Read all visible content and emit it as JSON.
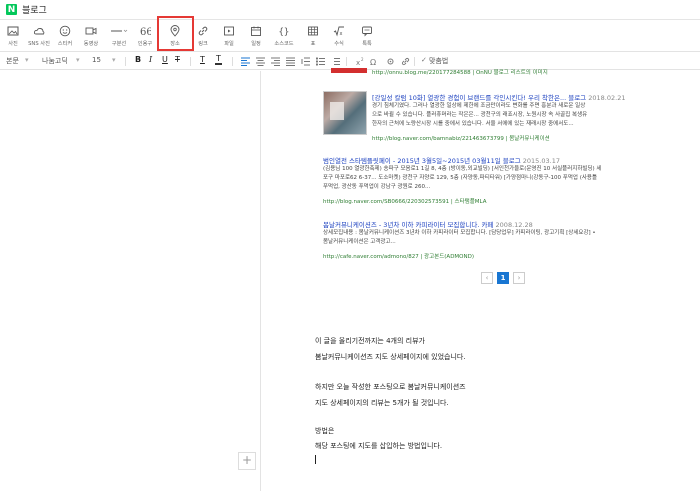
{
  "app": {
    "logo": "N",
    "title": "블로그"
  },
  "toolbar": {
    "items": [
      {
        "label": "사진",
        "icon": "photo-icon"
      },
      {
        "label": "SNS 사진",
        "icon": "cloud-icon"
      },
      {
        "label": "스티커",
        "icon": "sticker-icon"
      },
      {
        "label": "동영상",
        "icon": "video-icon"
      },
      {
        "label": "구분선",
        "icon": "divider-icon"
      },
      {
        "label": "인용구",
        "icon": "quote-icon"
      },
      {
        "label": "장소",
        "icon": "place-icon"
      },
      {
        "label": "링크",
        "icon": "link-icon"
      },
      {
        "label": "파일",
        "icon": "file-icon"
      },
      {
        "label": "일정",
        "icon": "calendar-icon"
      },
      {
        "label": "소스코드",
        "icon": "code-icon"
      },
      {
        "label": "표",
        "icon": "table-icon"
      },
      {
        "label": "수식",
        "icon": "formula-icon"
      },
      {
        "label": "톡톡",
        "icon": "talk-icon"
      }
    ]
  },
  "format": {
    "style": "본문",
    "font": "나눔고딕",
    "size": "15",
    "bold": "B",
    "italic": "I",
    "underline": "U",
    "strike": "T",
    "color": "T",
    "bgcolor": "T",
    "spellcheck": "맞춤법"
  },
  "results": [
    {
      "url": "http://onnu.blog.me/220177284588 | OnNU 블로그 리스트의 이미지"
    },
    {
      "title": "[강일성 칼럼 10화] 열광한 경험이 브랜드를 각인시킨다! 우리 착한은... 블로그",
      "date": "2018.02.21",
      "desc": [
        "경기 침체기였다. 그러나 열광한 일상에 제한에 조금만이라도 변화를 주면 흥분과 새로운 일상",
        "으로 바뀔 수 있습니다. 플러휴머라는 작은은... 광천구의 래죠시장, 노원시장 속 사골집 복생유",
        "한자의 근처에 노량산시장 시를 중에서 있습니다. 서울 서에에 있는 재래시장 중에서도..."
      ],
      "url": "http://blog.naver.com/bamnabiz/221463673799 | 봄날커뮤니케이션"
    },
    {
      "title": "범인열전 스타템플릿페이 - 2015년 3월5일~2015년 03월11일 블로그",
      "date": "2015.03.17",
      "desc": [
        "(김용님 100 열광한축제) 송파구 모음로1 1길 8, 4층 (방이동,외교빌딩) [서인천가을로(운영진 10 서실플러지하빌딩) 세",
        "포구 마포로62 6-37... 도소마켓) 광천구 자양로 129, 5층 (자양동,파티타워) [가양점마니(강동구-100 푸먹업 (사용틀",
        "푸먹업, 광산동 푸먹업이 강남구 광원로 260..."
      ],
      "url": "http://blog.naver.com/SB0666/220302573591 | 스타탬플MLA"
    },
    {
      "title": "봄날커뮤니케이션즈 - 3년차 이하 카피라이터 모집합니다. 카페",
      "date": "2008.12.28",
      "desc": [
        "상세모집내용 : 봄날커뮤니케이션즈 3년차 이하 카피라이터 모집합니다. [담당업무] 카피라이팅, 광고기획 [상세요강] •",
        "봄날커뮤니케이션은 고객광고..."
      ],
      "url": "http://cafe.naver.com/admono/827 | 광고본드(ADMOND)"
    }
  ],
  "pager": {
    "prev": "‹",
    "current": "1",
    "next": "›"
  },
  "body": {
    "lines": [
      "이 글을 올리기전까지는 4개의 리뷰가",
      "봄날커뮤니케이션즈 지도 상세페이지에 있었습니다.",
      "하지만 오늘 작성한 포스팅으로 봄날커뮤니케이션즈",
      "지도 상세페이지의 리뷰는 5개가 될 것입니다.",
      "방법은",
      "해당 포스팅에 지도를 삽입하는 방법입니다."
    ]
  },
  "add_button": "+",
  "colors": {
    "accent": "#03c75a",
    "highlight": "#e53935",
    "link": "#1a3fbf",
    "url": "#2e7d32"
  }
}
